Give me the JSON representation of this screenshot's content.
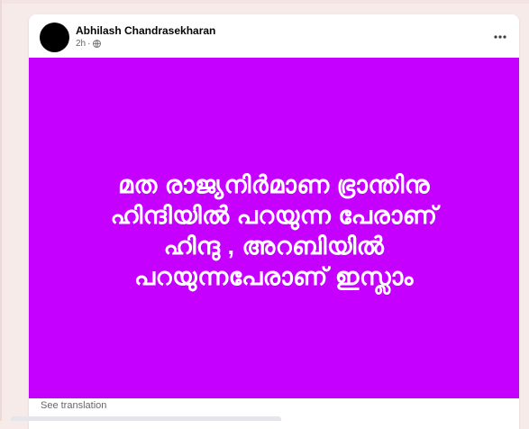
{
  "post": {
    "author_name": "Abhilash Chandrasekharan",
    "timestamp": "2h",
    "meta_separator": "·",
    "privacy_icon": "globe-icon",
    "more_icon": "more-horizontal-icon",
    "see_translation": "See translation"
  },
  "image": {
    "background_color": "#c600ff",
    "text_lines": [
      "മത രാജ്യനിർമാണ ഭ്രാന്തിനു",
      "ഹിന്ദിയിൽ പറയുന്ന പേരാണ്",
      "ഹിന്ദു , അറബിയിൽ",
      "പറയുന്നപേരാണ് ഇസ്ലാം"
    ]
  }
}
